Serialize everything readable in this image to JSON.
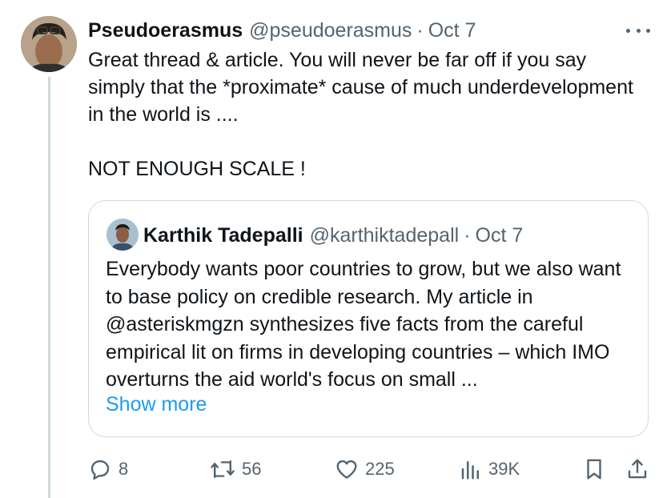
{
  "tweet": {
    "author_name": "Pseudoerasmus",
    "author_handle": "@pseudoerasmus",
    "separator": "·",
    "date": "Oct 7",
    "text": "Great thread & article. You will never be far off if you say simply that the *proximate* cause of much underdevelopment in the world is ....\n\nNOT ENOUGH SCALE !",
    "avatar_icon": "profile-photo-icon",
    "more_icon": "more-icon"
  },
  "quoted_tweet": {
    "author_name": "Karthik Tadepalli",
    "author_handle": "@karthiktadepall",
    "separator": "·",
    "date": "Oct 7",
    "text": "Everybody wants poor countries to grow, but we also want to base policy on credible research. My article in @asteriskmgzn synthesizes five facts from the careful empirical lit on firms in developing countries – which IMO overturns the aid world's focus on small ...",
    "show_more_label": "Show more"
  },
  "actions": {
    "replies": "8",
    "reposts": "56",
    "likes": "225",
    "views": "39K"
  },
  "colors": {
    "text": "#0f1419",
    "secondary": "#536471",
    "link": "#1d9bf0",
    "border": "#cfd9de"
  }
}
